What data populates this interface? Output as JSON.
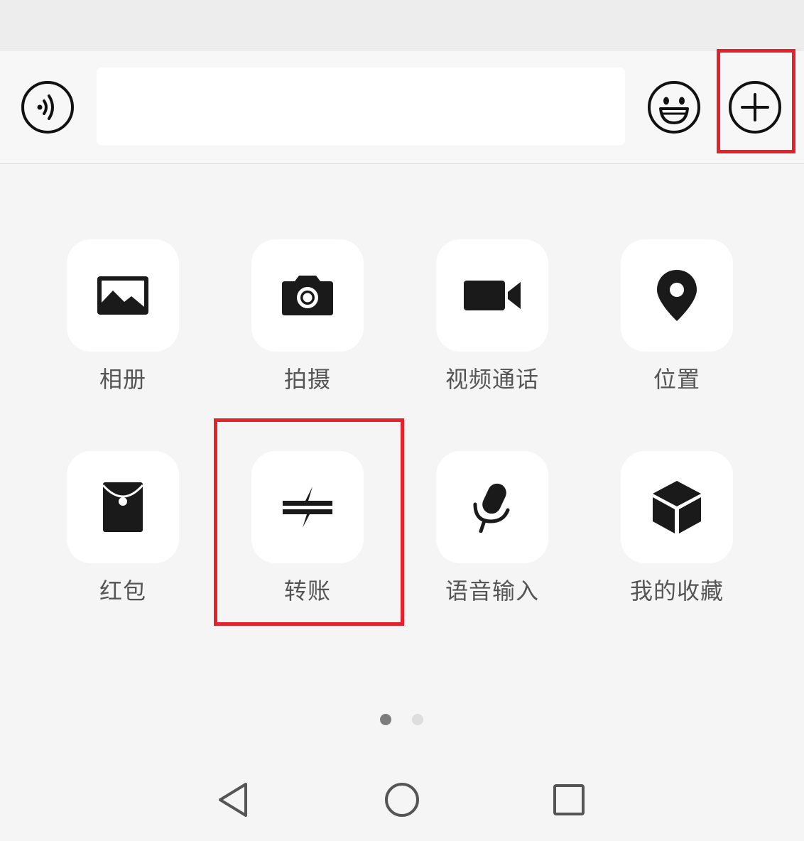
{
  "input_bar": {
    "text_value": "",
    "voice_icon": "voice-wave-icon",
    "emoji_icon": "smiley-icon",
    "plus_icon": "plus-circle-icon"
  },
  "panel": {
    "items": [
      {
        "label": "相册",
        "icon": "photo-album-icon"
      },
      {
        "label": "拍摄",
        "icon": "camera-icon"
      },
      {
        "label": "视频通话",
        "icon": "video-camera-icon"
      },
      {
        "label": "位置",
        "icon": "location-pin-icon"
      },
      {
        "label": "红包",
        "icon": "red-packet-icon"
      },
      {
        "label": "转账",
        "icon": "transfer-icon"
      },
      {
        "label": "语音输入",
        "icon": "microphone-icon"
      },
      {
        "label": "我的收藏",
        "icon": "favorites-cube-icon"
      }
    ],
    "page_indicator": {
      "current": 1,
      "total": 2
    }
  },
  "system_nav": {
    "back_icon": "back-triangle-icon",
    "home_icon": "home-circle-icon",
    "recents_icon": "recents-square-icon"
  },
  "colors": {
    "highlight": "#e5222b",
    "background": "#f5f5f5",
    "tile": "#ffffff",
    "label_text": "#555555",
    "icon": "#1a1a1a"
  }
}
